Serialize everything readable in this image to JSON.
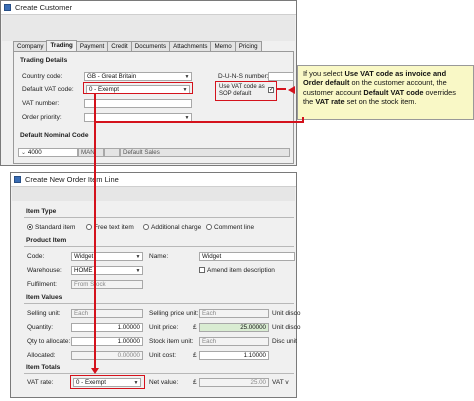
{
  "customer_window": {
    "title": "Create Customer",
    "tabs": [
      "Company",
      "Trading",
      "Payment",
      "Credit",
      "Documents",
      "Attachments",
      "Memo",
      "Pricing"
    ],
    "active_tab": "Trading",
    "trading_details_heading": "Trading Details",
    "country_code_label": "Country code:",
    "country_code_value": "GB - Great Britain",
    "duns_label": "D-U-N-S number:",
    "default_vat_label": "Default VAT code:",
    "default_vat_value": "0 - Exempt",
    "use_vat_label": "Use VAT code as SOP default",
    "vat_number_label": "VAT number:",
    "order_priority_label": "Order priority:",
    "nominal_heading": "Default Nominal Code",
    "nominal_account": "4000",
    "nominal_cost_centre": "MAN",
    "nominal_department": "",
    "nominal_description": "Default Sales"
  },
  "callout": {
    "pre": "If you select ",
    "b1": "Use VAT code as invoice and Order default",
    "mid1": " on the customer account, the customer account ",
    "b2": "Default VAT code",
    "mid2": " overrides the ",
    "b3": "VAT rate",
    "post": " set on the stock item."
  },
  "order_window": {
    "title": "Create New Order Item Line",
    "item_type_heading": "Item Type",
    "item_types": [
      "Standard item",
      "Free text item",
      "Additional charge",
      "Comment line"
    ],
    "product_item_heading": "Product Item",
    "code_label": "Code:",
    "code_value": "Widget",
    "name_label": "Name:",
    "name_value": "Widget",
    "warehouse_label": "Warehouse:",
    "warehouse_value": "HOME",
    "amend_label": "Amend item description",
    "fulfilment_label": "Fulfilment:",
    "fulfilment_value": "From Stock",
    "item_values_heading": "Item Values",
    "selling_unit_label": "Selling unit:",
    "selling_unit_value": "Each",
    "selling_price_unit_label": "Selling price unit:",
    "selling_price_unit_value": "Each",
    "unit_disco_label": "Unit disco",
    "quantity_label": "Quantity:",
    "quantity_value": "1.00000",
    "unit_price_label": "Unit price:",
    "unit_price_currency": "£",
    "unit_price_value": "25.00000",
    "unit_disco2_label": "Unit disco",
    "qty_allocate_label": "Qty to allocate:",
    "qty_allocate_value": "1.00000",
    "stock_unit_label": "Stock item unit:",
    "stock_unit_value": "Each",
    "disc_unit_label": "Disc unit",
    "allocated_label": "Allocated:",
    "allocated_value": "0.00000",
    "unit_cost_label": "Unit cost:",
    "unit_cost_currency": "£",
    "unit_cost_value": "1.10000",
    "item_totals_heading": "Item Totals",
    "vat_rate_label": "VAT rate:",
    "vat_rate_value": "0 - Exempt",
    "net_value_label": "Net value:",
    "net_value_currency": "£",
    "net_value_value": "25.00",
    "vat_label": "VAT v"
  },
  "colors": {
    "highlight": "#d4121c",
    "callout_bg": "#f9f8c6"
  }
}
